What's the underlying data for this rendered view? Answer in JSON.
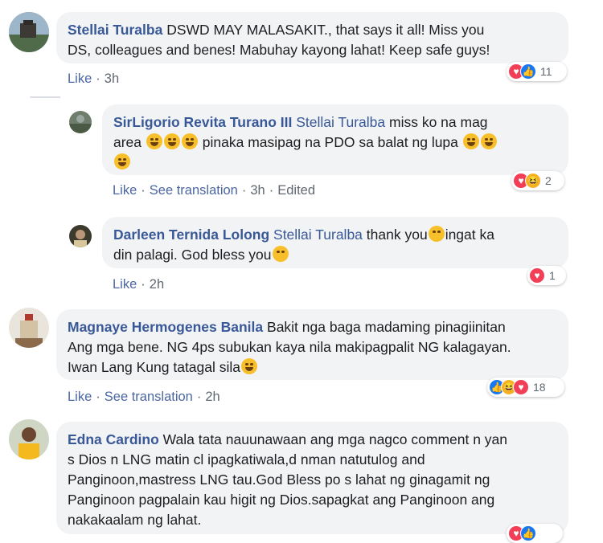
{
  "comments": [
    {
      "author": "Stellai Turalba",
      "text": "DSWD MAY MALASAKIT., that says it all! Miss you",
      "text2": "DS, colleagues and benes! Mabuhay kayong lahat! Keep safe guys!",
      "like": "Like",
      "time": "3h",
      "reaction_count": "11"
    },
    {
      "author": "SirLigorio Revita Turano III",
      "mention": "Stellai Turalba",
      "text": "miss ko na mag",
      "text2a": "area",
      "text2b": "pinaka masipag na PDO sa balat ng lupa",
      "like": "Like",
      "see_translation": "See translation",
      "time": "3h",
      "edited": "Edited",
      "reaction_count": "2"
    },
    {
      "author": "Darleen Ternida Lolong",
      "mention": "Stellai Turalba",
      "text": "thank you",
      "text1b": "ingat ka",
      "text2": "din palagi. God bless you",
      "like": "Like",
      "time": "2h",
      "reaction_count": "1"
    },
    {
      "author": "Magnaye Hermogenes Banila",
      "text": "Bakit nga baga madaming pinagiinitan",
      "text2": "Ang mga bene. NG 4ps subukan kaya nila makipagpalit NG kalagayan.",
      "text3": "Iwan Lang Kung tatagal sila",
      "like": "Like",
      "see_translation": "See translation",
      "time": "2h",
      "reaction_count": "18"
    },
    {
      "author": "Edna Cardino",
      "text": "Wala tata nauunawaan ang mga nagco comment n yan",
      "text2": "s Dios n LNG matin cl ipagkatiwala,d nman natutulog and",
      "text3": "Panginoon,mastress LNG tau.God Bless po s lahat ng ginagamit ng",
      "text4": "Panginoon pagpalain kau higit ng Dios.sapagkat ang Panginoon ang",
      "text5": "nakakaalam ng lahat."
    }
  ],
  "colors": {
    "author": "#385898",
    "bubble": "#f2f3f5",
    "meta": "#606770"
  }
}
